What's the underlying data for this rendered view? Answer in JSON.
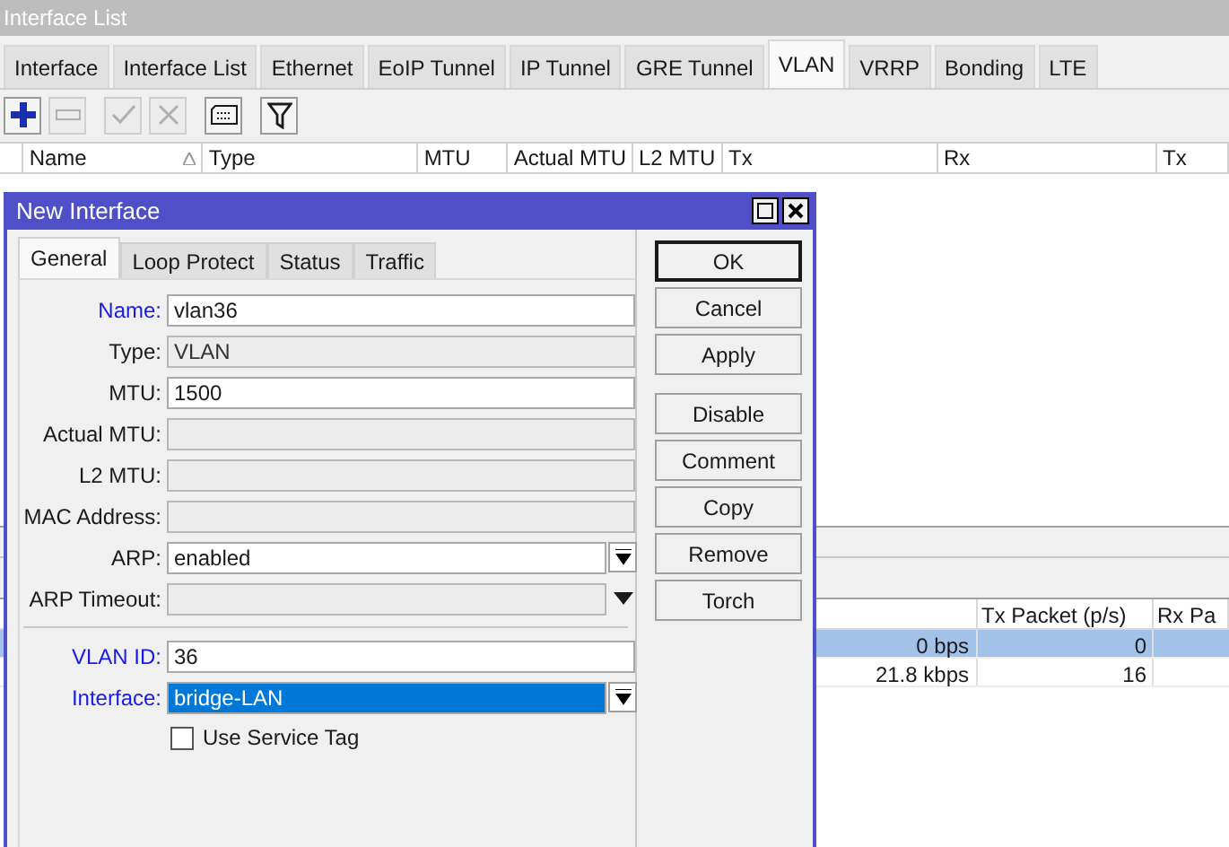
{
  "window": {
    "title": "Interface List"
  },
  "tabs": [
    {
      "label": "Interface",
      "selected": false
    },
    {
      "label": "Interface List",
      "selected": false
    },
    {
      "label": "Ethernet",
      "selected": false
    },
    {
      "label": "EoIP Tunnel",
      "selected": false
    },
    {
      "label": "IP Tunnel",
      "selected": false
    },
    {
      "label": "GRE Tunnel",
      "selected": false
    },
    {
      "label": "VLAN",
      "selected": true
    },
    {
      "label": "VRRP",
      "selected": false
    },
    {
      "label": "Bonding",
      "selected": false
    },
    {
      "label": "LTE",
      "selected": false
    }
  ],
  "toolbar": [
    {
      "kind": "add",
      "disabled": false
    },
    {
      "kind": "remove",
      "disabled": true
    },
    {
      "kind": "enable",
      "disabled": true
    },
    {
      "kind": "disable",
      "disabled": true
    },
    {
      "kind": "comment",
      "disabled": false
    },
    {
      "kind": "filter",
      "disabled": false
    }
  ],
  "table": {
    "columns": [
      {
        "label": "Name",
        "sorted": true
      },
      {
        "label": "Type",
        "sorted": false
      },
      {
        "label": "MTU",
        "sorted": false
      },
      {
        "label": "Actual MTU",
        "sorted": false
      },
      {
        "label": "L2 MTU",
        "sorted": false
      },
      {
        "label": "Tx",
        "sorted": false
      },
      {
        "label": "Rx",
        "sorted": false
      },
      {
        "label": "Tx",
        "sorted": false
      }
    ]
  },
  "traffic_table": {
    "columns": [
      "Tx Packet (p/s)",
      "Rx Pa"
    ],
    "rows": [
      {
        "rate": "0 bps",
        "tx_packet": "0",
        "selected": true
      },
      {
        "rate": "21.8 kbps",
        "tx_packet": "16",
        "selected": false
      }
    ]
  },
  "dialog": {
    "title": "New Interface",
    "tabs": [
      {
        "label": "General",
        "selected": true
      },
      {
        "label": "Loop Protect",
        "selected": false
      },
      {
        "label": "Status",
        "selected": false
      },
      {
        "label": "Traffic",
        "selected": false
      }
    ],
    "fields": [
      {
        "label": "Name:",
        "value": "vlan36",
        "kind": "text",
        "required": true
      },
      {
        "label": "Type:",
        "value": "VLAN",
        "kind": "readonly",
        "required": false
      },
      {
        "label": "MTU:",
        "value": "1500",
        "kind": "text",
        "required": false
      },
      {
        "label": "Actual MTU:",
        "kind": "readonly",
        "required": false
      },
      {
        "label": "L2 MTU:",
        "kind": "readonly",
        "required": false
      },
      {
        "label": "MAC Address:",
        "kind": "readonly",
        "required": false
      },
      {
        "label": "ARP:",
        "value": "enabled",
        "kind": "dropdown",
        "required": false
      },
      {
        "label": "ARP Timeout:",
        "kind": "collapsed",
        "required": false
      }
    ],
    "vlan_fields": [
      {
        "label": "VLAN ID:",
        "value": "36",
        "kind": "text",
        "required": true,
        "selected": false
      },
      {
        "label": "Interface:",
        "value": "bridge-LAN",
        "kind": "dropdown",
        "required": true,
        "selected": true
      }
    ],
    "checkbox": {
      "label": "Use Service Tag",
      "checked": false
    },
    "buttons": [
      {
        "label": "OK",
        "default": true
      },
      {
        "label": "Cancel",
        "default": false
      },
      {
        "label": "Apply",
        "default": false
      }
    ],
    "action_buttons": [
      {
        "label": "Disable",
        "default": false
      },
      {
        "label": "Comment",
        "default": false
      },
      {
        "label": "Copy",
        "default": false
      },
      {
        "label": "Remove",
        "default": false
      },
      {
        "label": "Torch",
        "default": false
      }
    ]
  }
}
